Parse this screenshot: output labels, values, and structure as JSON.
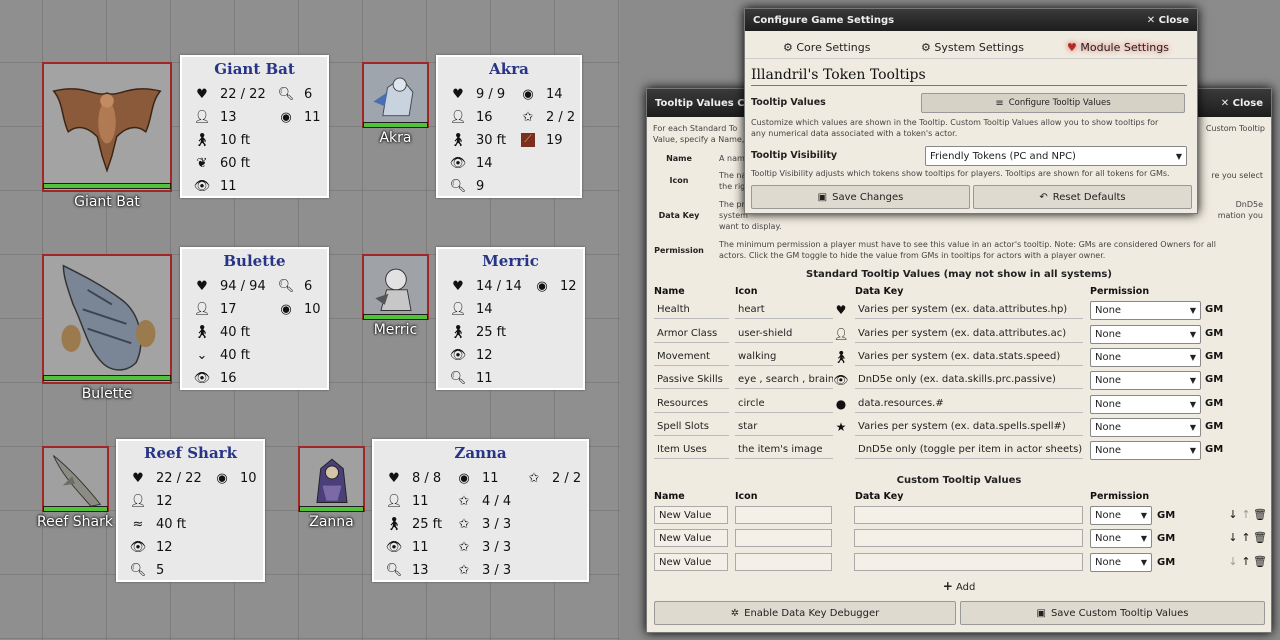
{
  "tokens": [
    {
      "name": "Giant Bat",
      "stats": [
        "22 / 22",
        "6",
        "13",
        "11",
        "10 ft",
        "60 ft",
        "11"
      ]
    },
    {
      "name": "Akra",
      "stats": [
        "9 / 9",
        "14",
        "16",
        "2 / 2",
        "30 ft",
        "19",
        "14",
        "9"
      ]
    },
    {
      "name": "Bulette",
      "stats": [
        "94 / 94",
        "6",
        "17",
        "10",
        "40 ft",
        "40 ft",
        "16"
      ]
    },
    {
      "name": "Merric",
      "stats": [
        "14 / 14",
        "12",
        "14",
        "25 ft",
        "12",
        "11"
      ]
    },
    {
      "name": "Reef Shark",
      "stats": [
        "22 / 22",
        "10",
        "12",
        "40 ft",
        "12",
        "5"
      ]
    },
    {
      "name": "Zanna",
      "stats": [
        "8 / 8",
        "11",
        "2 / 2",
        "11",
        "4 / 4",
        "25 ft",
        "3 / 3",
        "11",
        "3 / 3",
        "13",
        "3 / 3"
      ]
    }
  ],
  "settings": {
    "title": "Configure Game Settings",
    "close": "Close",
    "tabs": [
      "Core Settings",
      "System Settings",
      "Module Settings"
    ],
    "module_title": "Illandril's Token Tooltips",
    "tooltip_values_label": "Tooltip Values",
    "configure_btn": "Configure Tooltip Values",
    "tooltip_values_hint": "Customize which values are shown in the Tooltip. Custom Tooltip Values allow you to show tooltips for any numerical data associated with a token's actor.",
    "visibility_label": "Tooltip Visibility",
    "visibility_value": "Friendly Tokens (PC and NPC)",
    "visibility_hint": "Tooltip Visibility adjusts which tokens show tooltips for players. Tooltips are shown for all tokens for GMs.",
    "save_btn": "Save Changes",
    "reset_btn": "Reset Defaults"
  },
  "tvc": {
    "title": "Tooltip Values Confi",
    "close": "Close",
    "intro_left": "For each Standard To",
    "intro_right": "Custom Tooltip",
    "intro2_left": "Value, specify a Name,",
    "help": [
      {
        "label": "Name",
        "text": "A nam"
      },
      {
        "label": "Icon",
        "text": "The na",
        "right": "re you select"
      },
      {
        "label": "",
        "text": "the rig"
      },
      {
        "label": "Data Key",
        "text": "The pr",
        "right": "DnD5e"
      },
      {
        "label": "",
        "text": "system",
        "right": "mation you"
      },
      {
        "label": "",
        "text": "want to display."
      },
      {
        "label": "Permission",
        "text": "The minimum permission a player must have to see this value in an actor's tooltip. Note: GMs are considered Owners for all actors. Click the GM toggle to hide the value from GMs in tooltips for actors with a player owner."
      }
    ],
    "standard_heading": "Standard Tooltip Values (may not show in all systems)",
    "col_name": "Name",
    "col_icon": "Icon",
    "col_key": "Data Key",
    "col_perm": "Permission",
    "gm": "GM",
    "rows": [
      {
        "name": "Health",
        "icon": "heart",
        "key": "Varies per system (ex. data.attributes.hp)",
        "perm": "None"
      },
      {
        "name": "Armor Class",
        "icon": "user-shield",
        "key": "Varies per system (ex. data.attributes.ac)",
        "perm": "None"
      },
      {
        "name": "Movement",
        "icon": "walking",
        "key": "Varies per system (ex. data.stats.speed)",
        "perm": "None"
      },
      {
        "name": "Passive Skills",
        "icon": "eye , search , brain",
        "key": "DnD5e only (ex. data.skills.prc.passive)",
        "perm": "None"
      },
      {
        "name": "Resources",
        "icon": "circle",
        "key": "data.resources.#",
        "perm": "None"
      },
      {
        "name": "Spell Slots",
        "icon": "star",
        "key": "Varies per system (ex. data.spells.spell#)",
        "perm": "None"
      },
      {
        "name": "Item Uses",
        "icon": "the item's image",
        "key": "DnD5e only (toggle per item in actor sheets)",
        "perm": "None"
      }
    ],
    "custom_heading": "Custom Tooltip Values",
    "custom_rows": [
      {
        "name": "New Value",
        "perm": "None"
      },
      {
        "name": "New Value",
        "perm": "None"
      },
      {
        "name": "New Value",
        "perm": "None"
      }
    ],
    "add": "Add",
    "debug_btn": "Enable Data Key Debugger",
    "save_btn": "Save Custom Tooltip Values"
  }
}
